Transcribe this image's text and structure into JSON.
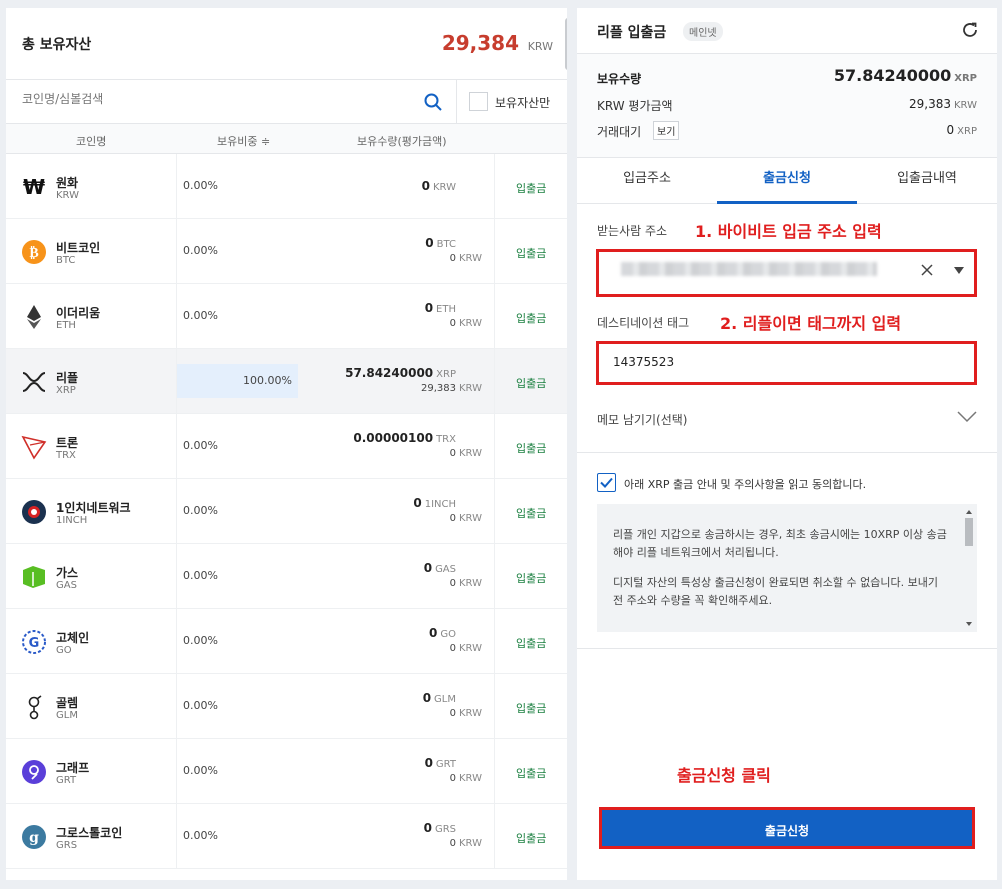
{
  "left": {
    "total_label": "총 보유자산",
    "total_value": "29,384",
    "total_unit": "KRW",
    "search_placeholder": "코인명/심볼검색",
    "own_only_label": "보유자산만",
    "columns": [
      "코인명",
      "보유비중 ≑",
      "보유수량(평가금액)"
    ],
    "io_label": "입출금",
    "coins": [
      {
        "name": "원화",
        "symbol": "KRW",
        "pct": "0.00%",
        "qty": "0",
        "qty_unit": "KRW",
        "krw": "",
        "icon": "krw-icon"
      },
      {
        "name": "비트코인",
        "symbol": "BTC",
        "pct": "0.00%",
        "qty": "0",
        "qty_unit": "BTC",
        "krw": "0",
        "icon": "btc-icon"
      },
      {
        "name": "이더리움",
        "symbol": "ETH",
        "pct": "0.00%",
        "qty": "0",
        "qty_unit": "ETH",
        "krw": "0",
        "icon": "eth-icon"
      },
      {
        "name": "리플",
        "symbol": "XRP",
        "pct": "100.00%",
        "qty": "57.84240000",
        "qty_unit": "XRP",
        "krw": "29,383",
        "icon": "xrp-icon",
        "selected": true
      },
      {
        "name": "트론",
        "symbol": "TRX",
        "pct": "0.00%",
        "qty": "0.00000100",
        "qty_unit": "TRX",
        "krw": "0",
        "icon": "trx-icon"
      },
      {
        "name": "1인치네트워크",
        "symbol": "1INCH",
        "pct": "0.00%",
        "qty": "0",
        "qty_unit": "1INCH",
        "krw": "0",
        "icon": "1inch-icon"
      },
      {
        "name": "가스",
        "symbol": "GAS",
        "pct": "0.00%",
        "qty": "0",
        "qty_unit": "GAS",
        "krw": "0",
        "icon": "gas-icon"
      },
      {
        "name": "고체인",
        "symbol": "GO",
        "pct": "0.00%",
        "qty": "0",
        "qty_unit": "GO",
        "krw": "0",
        "icon": "go-icon"
      },
      {
        "name": "골렘",
        "symbol": "GLM",
        "pct": "0.00%",
        "qty": "0",
        "qty_unit": "GLM",
        "krw": "0",
        "icon": "glm-icon"
      },
      {
        "name": "그래프",
        "symbol": "GRT",
        "pct": "0.00%",
        "qty": "0",
        "qty_unit": "GRT",
        "krw": "0",
        "icon": "grt-icon"
      },
      {
        "name": "그로스톨코인",
        "symbol": "GRS",
        "pct": "0.00%",
        "qty": "0",
        "qty_unit": "GRS",
        "krw": "0",
        "icon": "grs-icon"
      }
    ],
    "krw_unit": "KRW"
  },
  "right": {
    "title": "리플 입출금",
    "net_badge": "메인넷",
    "holding_label": "보유수량",
    "holding_value": "57.84240000",
    "holding_unit": "XRP",
    "krw_label": "KRW 평가금액",
    "krw_value": "29,383",
    "krw_unit": "KRW",
    "pending_label": "거래대기",
    "view_btn": "보기",
    "pending_value": "0",
    "pending_unit": "XRP",
    "tabs": [
      "입금주소",
      "출금신청",
      "입출금내역"
    ],
    "recipient_label": "받는사람 주소",
    "anno1": "1. 바이비트 입금 주소 입력",
    "tag_label": "데스티네이션 태그",
    "anno2": "2. 리플이면 태그까지 입력",
    "tag_value": "14375523",
    "memo_label": "메모 남기기(선택)",
    "agree_text": "아래 XRP 출금 안내 및 주의사항을 읽고 동의합니다.",
    "notice_p1": "리플 개인 지갑으로 송금하시는 경우, 최초 송금시에는 10XRP 이상 송금해야 리플 네트워크에서 처리됩니다.",
    "notice_p2": "디지털 자산의 특성상 출금신청이 완료되면 취소할 수 없습니다. 보내기 전 주소와 수량을 꼭 확인해주세요.",
    "click_anno": "출금신청 클릭",
    "withdraw_btn": "출금신청"
  },
  "colors": {
    "accent": "#1261c4",
    "total": "#c73d2e",
    "annotation": "#e01e1e",
    "io_link": "#1a7f3f"
  }
}
